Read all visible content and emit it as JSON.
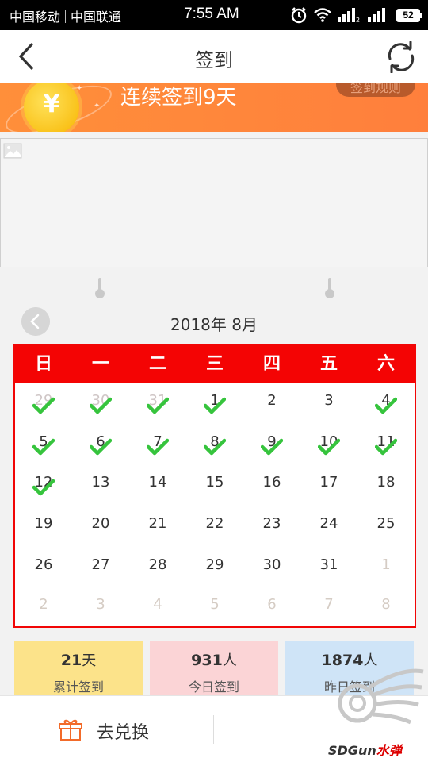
{
  "status_bar": {
    "carrier_1": "中国移动",
    "carrier_2": "中国联通",
    "time": "7:55 AM",
    "battery": "52",
    "icons": [
      "alarm-icon",
      "wifi-icon",
      "signal-icon",
      "signal-icon",
      "battery-icon"
    ]
  },
  "header": {
    "title": "签到",
    "back_icon": "chevron-left-icon",
    "refresh_icon": "refresh-icon"
  },
  "banner": {
    "streak_text": "连续签到9天",
    "rules_label": "签到规则",
    "coin_symbol": "¥"
  },
  "calendar": {
    "month_label": "2018年 8月",
    "weekdays": [
      "日",
      "一",
      "二",
      "三",
      "四",
      "五",
      "六"
    ],
    "accent_color": "#f40404",
    "check_color": "#36c43d",
    "rows": [
      [
        {
          "d": "29",
          "s": "prev",
          "c": true
        },
        {
          "d": "30",
          "s": "prev",
          "c": true
        },
        {
          "d": "31",
          "s": "prev",
          "c": true
        },
        {
          "d": "1",
          "s": "cur",
          "c": true
        },
        {
          "d": "2",
          "s": "cur",
          "c": false
        },
        {
          "d": "3",
          "s": "cur",
          "c": false
        },
        {
          "d": "4",
          "s": "cur",
          "c": true
        }
      ],
      [
        {
          "d": "5",
          "s": "cur",
          "c": true
        },
        {
          "d": "6",
          "s": "cur",
          "c": true
        },
        {
          "d": "7",
          "s": "cur",
          "c": true
        },
        {
          "d": "8",
          "s": "cur",
          "c": true
        },
        {
          "d": "9",
          "s": "cur",
          "c": true
        },
        {
          "d": "10",
          "s": "cur",
          "c": true
        },
        {
          "d": "11",
          "s": "cur",
          "c": true
        }
      ],
      [
        {
          "d": "12",
          "s": "cur",
          "c": true
        },
        {
          "d": "13",
          "s": "cur",
          "c": false
        },
        {
          "d": "14",
          "s": "cur",
          "c": false
        },
        {
          "d": "15",
          "s": "cur",
          "c": false
        },
        {
          "d": "16",
          "s": "cur",
          "c": false
        },
        {
          "d": "17",
          "s": "cur",
          "c": false
        },
        {
          "d": "18",
          "s": "cur",
          "c": false
        }
      ],
      [
        {
          "d": "19",
          "s": "cur",
          "c": false
        },
        {
          "d": "20",
          "s": "cur",
          "c": false
        },
        {
          "d": "21",
          "s": "cur",
          "c": false
        },
        {
          "d": "22",
          "s": "cur",
          "c": false
        },
        {
          "d": "23",
          "s": "cur",
          "c": false
        },
        {
          "d": "24",
          "s": "cur",
          "c": false
        },
        {
          "d": "25",
          "s": "cur",
          "c": false
        }
      ],
      [
        {
          "d": "26",
          "s": "cur",
          "c": false
        },
        {
          "d": "27",
          "s": "cur",
          "c": false
        },
        {
          "d": "28",
          "s": "cur",
          "c": false
        },
        {
          "d": "29",
          "s": "cur",
          "c": false
        },
        {
          "d": "30",
          "s": "cur",
          "c": false
        },
        {
          "d": "31",
          "s": "cur",
          "c": false
        },
        {
          "d": "1",
          "s": "next",
          "c": false
        }
      ],
      [
        {
          "d": "2",
          "s": "next",
          "c": false
        },
        {
          "d": "3",
          "s": "next",
          "c": false
        },
        {
          "d": "4",
          "s": "next",
          "c": false
        },
        {
          "d": "5",
          "s": "next",
          "c": false
        },
        {
          "d": "6",
          "s": "next",
          "c": false
        },
        {
          "d": "7",
          "s": "next",
          "c": false
        },
        {
          "d": "8",
          "s": "next",
          "c": false
        }
      ]
    ]
  },
  "stats": [
    {
      "value": "21",
      "unit": "天",
      "label": "累计签到",
      "color": "#fce38a"
    },
    {
      "value": "931",
      "unit": "人",
      "label": "今日签到",
      "color": "#fbd4d6"
    },
    {
      "value": "1874",
      "unit": "人",
      "label": "昨日签到",
      "color": "#cfe4f7"
    }
  ],
  "bottom_bar": {
    "exchange_label": "去兑换",
    "gift_icon": "gift-icon"
  },
  "watermark": {
    "text_main": "SDGun",
    "text_accent": "水弹"
  }
}
